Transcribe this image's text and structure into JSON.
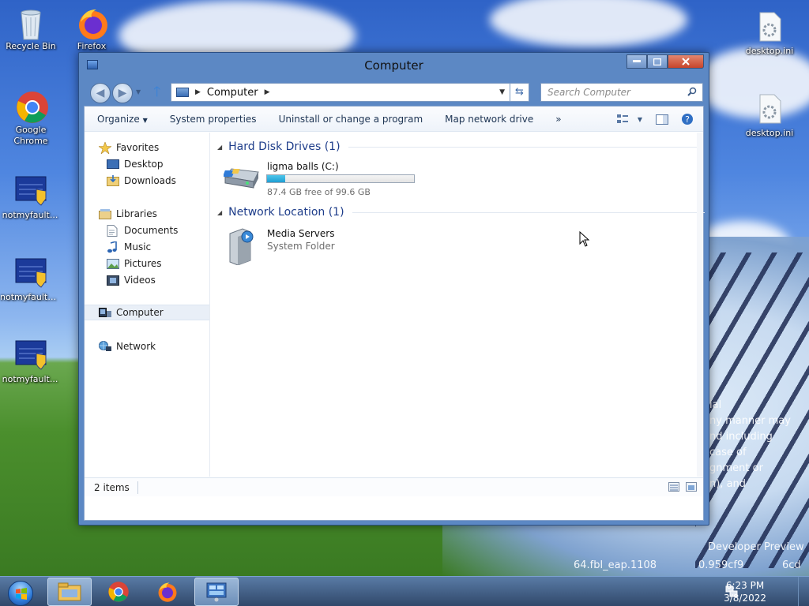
{
  "desktop": {
    "icons": [
      {
        "name": "recycle-bin",
        "label": "Recycle Bin"
      },
      {
        "name": "firefox",
        "label": "Firefox"
      },
      {
        "name": "google-chrome",
        "label": "Google Chrome"
      },
      {
        "name": "notmyfault-1",
        "label": "notmyfault..."
      },
      {
        "name": "notmyfault-2",
        "label": "notmyfault6..."
      },
      {
        "name": "notmyfault-3",
        "label": "notmyfault..."
      },
      {
        "name": "desktop-ini-1",
        "label": "desktop.ini"
      },
      {
        "name": "desktop-ini-2",
        "label": "desktop.ini"
      }
    ],
    "watermark_lines": [
      "ial",
      "ny manner may",
      "nd including",
      "case of",
      "gnment or",
      "n), and",
      "Developer Preview",
      "64.fbl_eap.1108",
      "0.959cf9",
      "6cd"
    ]
  },
  "window": {
    "title": "Computer",
    "address": "Computer",
    "search_placeholder": "Search Computer",
    "toolbar": {
      "organize": "Organize",
      "system_properties": "System properties",
      "uninstall": "Uninstall or change a program",
      "map_drive": "Map network drive",
      "more": "»"
    },
    "nav": {
      "favorites": "Favorites",
      "desktop": "Desktop",
      "downloads": "Downloads",
      "libraries": "Libraries",
      "documents": "Documents",
      "music": "Music",
      "pictures": "Pictures",
      "videos": "Videos",
      "computer": "Computer",
      "network": "Network"
    },
    "groups": {
      "hdd_header": "Hard Disk Drives (1)",
      "net_header": "Network Location (1)"
    },
    "drive": {
      "name": "ligma balls (C:)",
      "free_text": "87.4 GB free of 99.6 GB",
      "used_fraction": 0.122
    },
    "network_item": {
      "name": "Media Servers",
      "type": "System Folder"
    },
    "status": {
      "count": "2 items"
    }
  },
  "taskbar": {
    "time": "6:23 PM",
    "date": "3/8/2022"
  }
}
